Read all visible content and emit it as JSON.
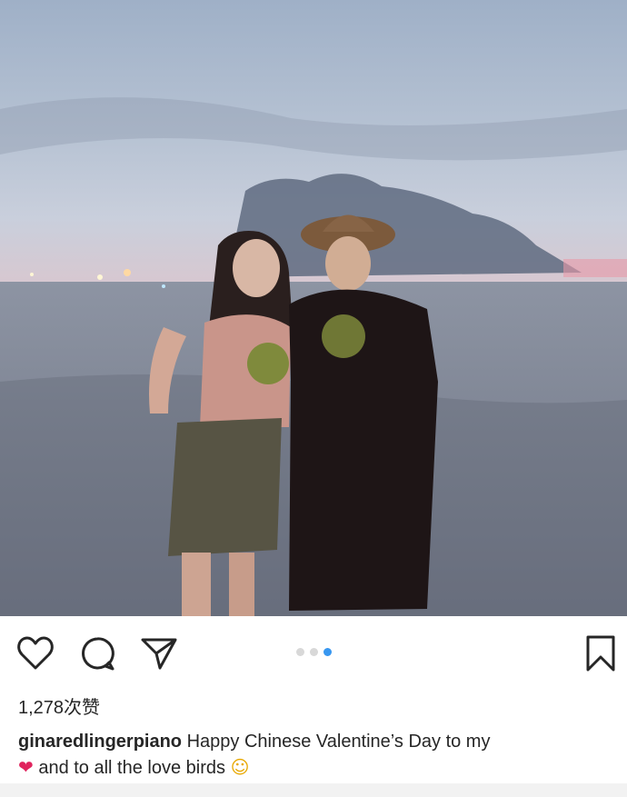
{
  "post": {
    "photo_alt": "",
    "carousel": {
      "count": 3,
      "active_index": 2
    },
    "likes_label": "1,278次赞",
    "caption": {
      "username": "ginaredlingerpiano",
      "text_line1": " Happy Chinese Valentine’s Day to my",
      "text_line2": " and to all the love birds ",
      "emoji_heart": "❤",
      "emoji_face": "☺"
    }
  },
  "icons": {
    "like": "heart-outline-icon",
    "comment": "comment-bubble-icon",
    "share": "paper-plane-icon",
    "save": "bookmark-icon"
  },
  "colors": {
    "text": "#262626",
    "active_dot": "#3897f0",
    "inactive_dot": "#d8d8d8"
  }
}
